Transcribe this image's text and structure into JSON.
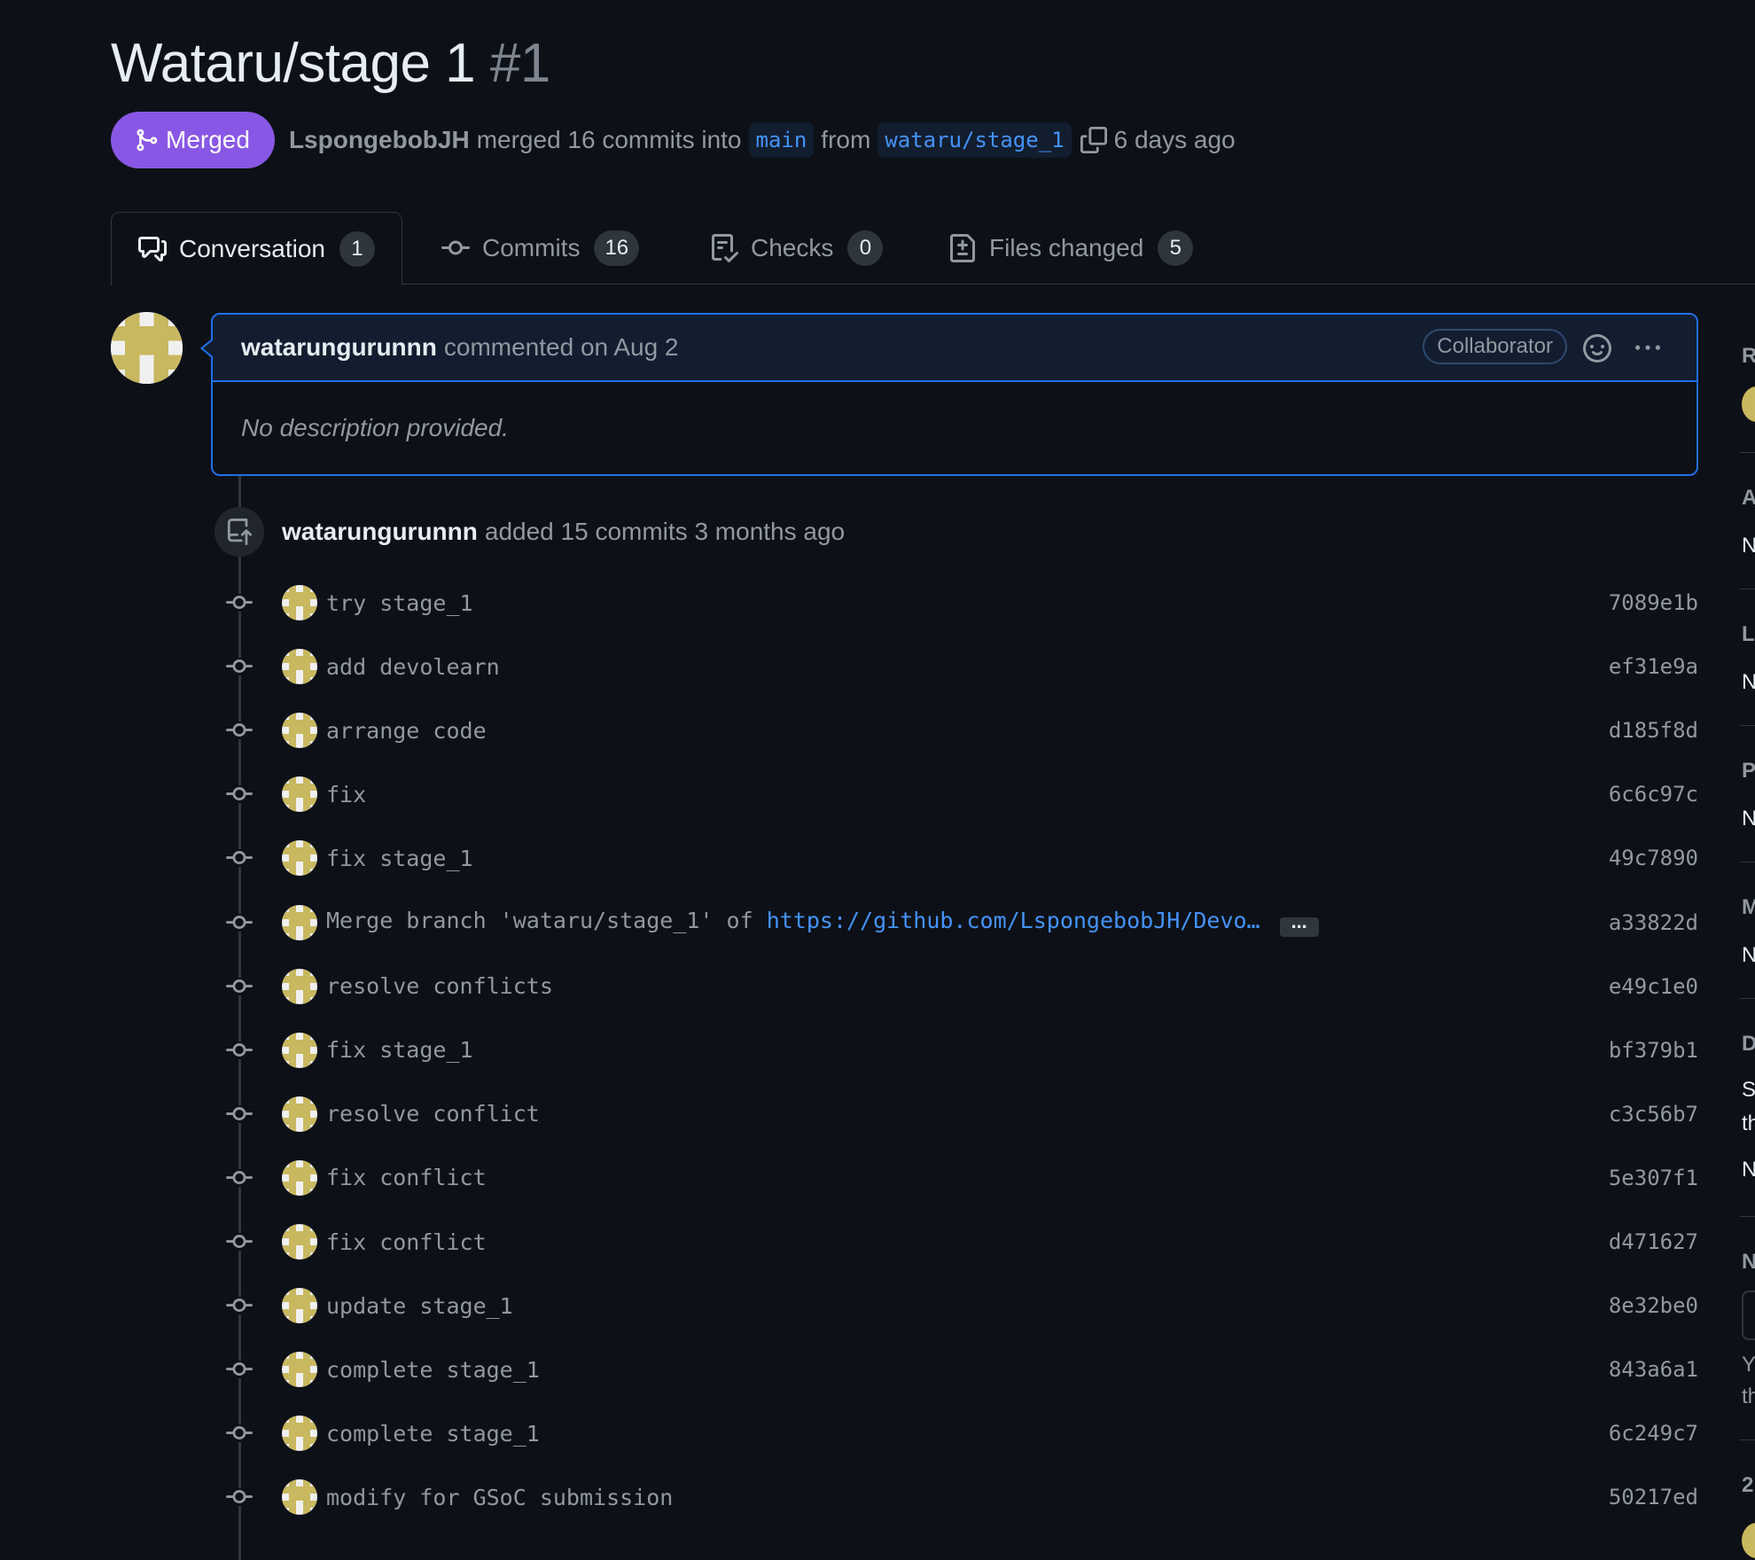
{
  "pr": {
    "title": "Wataru/stage 1",
    "number": "#1",
    "status": "Merged",
    "merger": "LspongebobJH",
    "merge_text": "merged 16 commits into",
    "base_branch": "main",
    "from_text": "from",
    "head_branch": "wataru/stage_1",
    "time_ago": "6 days ago"
  },
  "tabs": [
    {
      "label": "Conversation",
      "count": "1"
    },
    {
      "label": "Commits",
      "count": "16"
    },
    {
      "label": "Checks",
      "count": "0"
    },
    {
      "label": "Files changed",
      "count": "5"
    }
  ],
  "comment": {
    "author": "watarungurunnn",
    "action": "commented on Aug 2",
    "role": "Collaborator",
    "body": "No description provided."
  },
  "event": {
    "author": "watarungurunnn",
    "text": "added 15 commits 3 months ago"
  },
  "commits": [
    {
      "message": "try stage_1",
      "sha": "7089e1b"
    },
    {
      "message": "add devolearn",
      "sha": "ef31e9a"
    },
    {
      "message": "arrange code",
      "sha": "d185f8d"
    },
    {
      "message": "fix",
      "sha": "6c6c97c"
    },
    {
      "message": "fix stage_1",
      "sha": "49c7890"
    },
    {
      "message": "Merge branch 'wataru/stage_1' of ",
      "link": "https://github.com/LspongebobJH/Devo…",
      "sha": "a33822d"
    },
    {
      "message": "resolve conflicts",
      "sha": "e49c1e0"
    },
    {
      "message": "fix stage_1",
      "sha": "bf379b1"
    },
    {
      "message": "resolve conflict",
      "sha": "c3c56b7"
    },
    {
      "message": "fix conflict",
      "sha": "5e307f1"
    },
    {
      "message": "fix conflict",
      "sha": "d471627"
    },
    {
      "message": "update stage_1",
      "sha": "8e32be0"
    },
    {
      "message": "complete stage_1",
      "sha": "843a6a1"
    },
    {
      "message": "complete stage_1",
      "sha": "6c249c7"
    },
    {
      "message": "modify for GSoC submission",
      "sha": "50217ed"
    }
  ],
  "sidebar_letters": [
    "R",
    "A",
    "N",
    "L",
    "N",
    "P",
    "N",
    "M",
    "N",
    "D",
    "S",
    "th",
    "N",
    "N",
    "Y",
    "th",
    "2"
  ]
}
